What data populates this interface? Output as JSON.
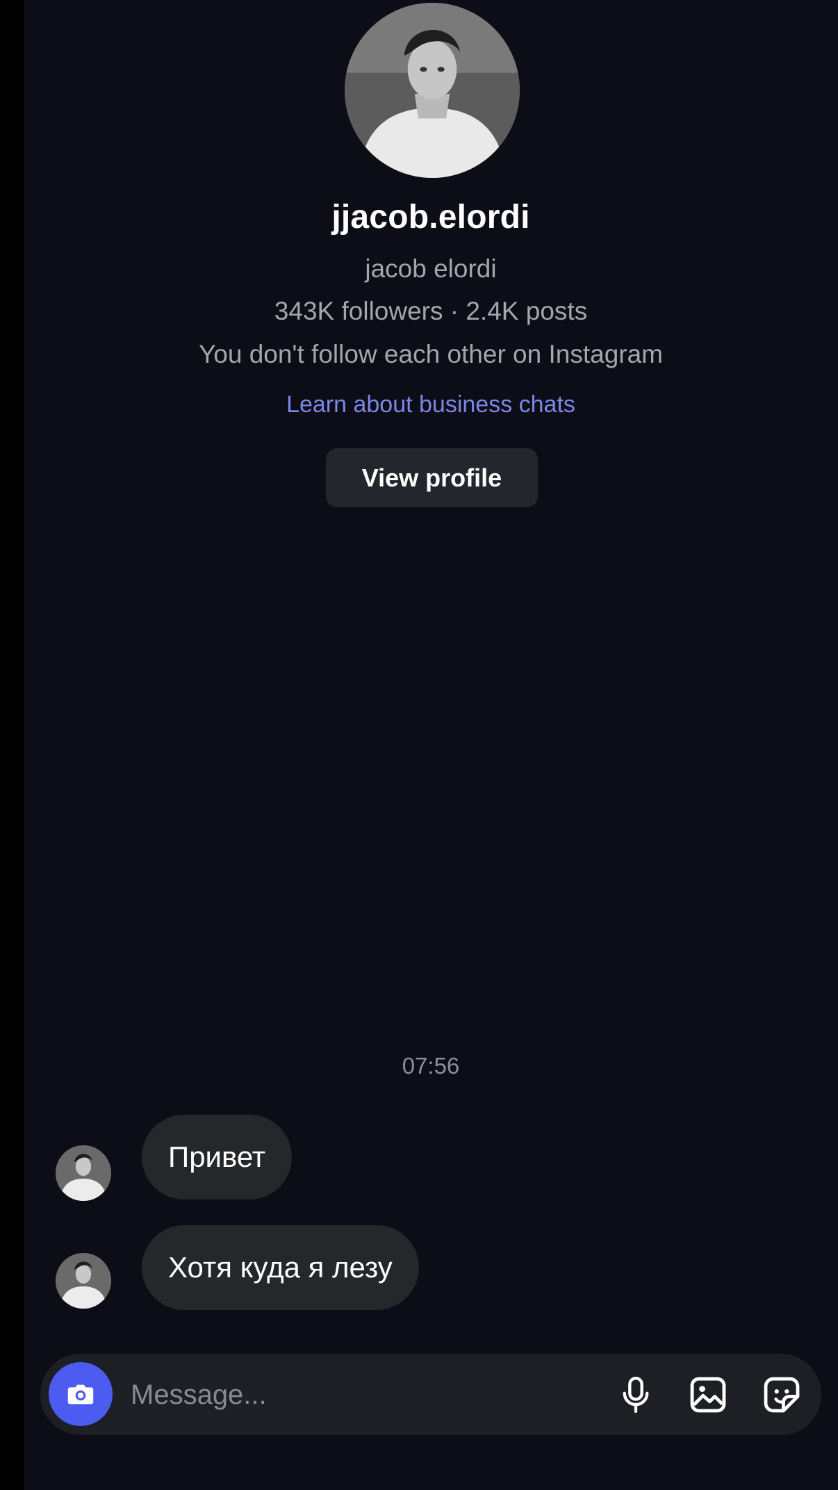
{
  "profile": {
    "username": "jjacob.elordi",
    "full_name": "jacob elordi",
    "stats": "343K followers · 2.4K posts",
    "follow_note": "You don't follow each other on Instagram",
    "business_link": "Learn about business chats",
    "view_profile_label": "View profile"
  },
  "thread": {
    "timestamp": "07:56",
    "messages": [
      {
        "sender": "jjacob.elordi",
        "text": "Привет"
      },
      {
        "sender": "jjacob.elordi",
        "text": "Хотя куда я лезу"
      }
    ]
  },
  "composer": {
    "placeholder": "Message...",
    "icons": [
      "camera-icon",
      "microphone-icon",
      "gallery-icon",
      "sticker-icon"
    ]
  },
  "colors": {
    "background": "#0c0d17",
    "bubble": "#26272b",
    "link": "#7b88e4",
    "camera_button": "#4c5bf0",
    "secondary_text": "#a4a6ae"
  }
}
